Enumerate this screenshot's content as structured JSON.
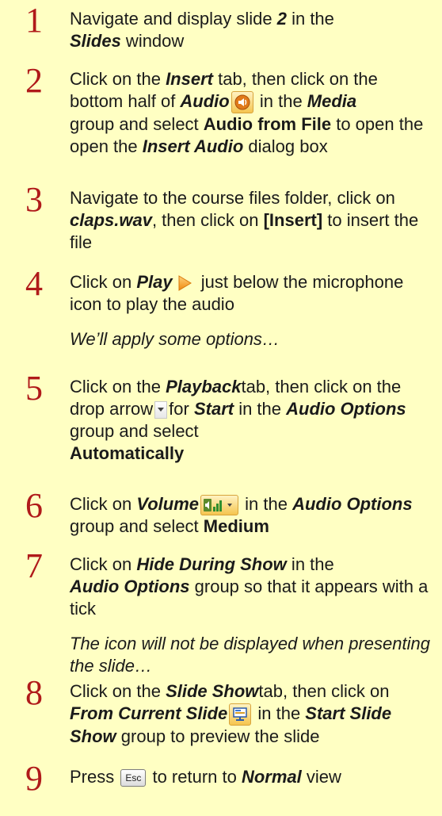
{
  "steps": [
    {
      "number": "1",
      "parts": [
        "Navigate and display slide ",
        "2",
        " in the ",
        "Slides",
        " window"
      ]
    },
    {
      "number": "2",
      "parts": [
        "Click on the ",
        "Insert",
        " tab, then click on the bottom half of ",
        "Audio",
        " in the ",
        "Media",
        " group and select ",
        "Audio from File",
        " to open the ",
        "Insert Audio",
        " dialog box"
      ],
      "icon": "audio-speaker-icon"
    },
    {
      "number": "3",
      "parts": [
        "Navigate to the course files folder, click on ",
        "claps.wav",
        ", then click on ",
        "[Insert]",
        " to insert the file"
      ]
    },
    {
      "number": "4",
      "parts": [
        "Click on ",
        "Play",
        " just below the microphone icon to play the audio"
      ],
      "icon": "play-triangle-icon",
      "note": "We’ll apply some options…"
    },
    {
      "number": "5",
      "parts": [
        "Click on the ",
        "Playback",
        " tab, then click on the drop arrow ",
        "for ",
        "Start",
        " in the ",
        "Audio Options",
        " group and select ",
        "Automatically"
      ],
      "icon": "dropdown-arrow-icon"
    },
    {
      "number": "6",
      "parts": [
        "Click on ",
        "Volume",
        " in the ",
        "Audio Options",
        " group and select ",
        "Medium"
      ],
      "icon": "volume-bars-icon"
    },
    {
      "number": "7",
      "parts": [
        "Click on ",
        "Hide During Show",
        " in the ",
        "Audio Options",
        " group so that it appears with a tick"
      ],
      "note": "The icon will not be displayed when presenting the slide…"
    },
    {
      "number": "8",
      "parts": [
        "Click on the ",
        "Slide Show",
        " tab, then click on ",
        "From Current Slide",
        " in the ",
        "Start Slide Show",
        " group to preview the slide"
      ],
      "icon": "slide-show-icon"
    },
    {
      "number": "9",
      "parts": [
        "Press ",
        " to return to ",
        "Normal",
        " view"
      ],
      "key_label": "Esc",
      "icon": "esc-key-icon"
    }
  ],
  "colors": {
    "background": "#FFFFC3",
    "step_number": "#B01A1A",
    "text": "#1a1a1a"
  }
}
